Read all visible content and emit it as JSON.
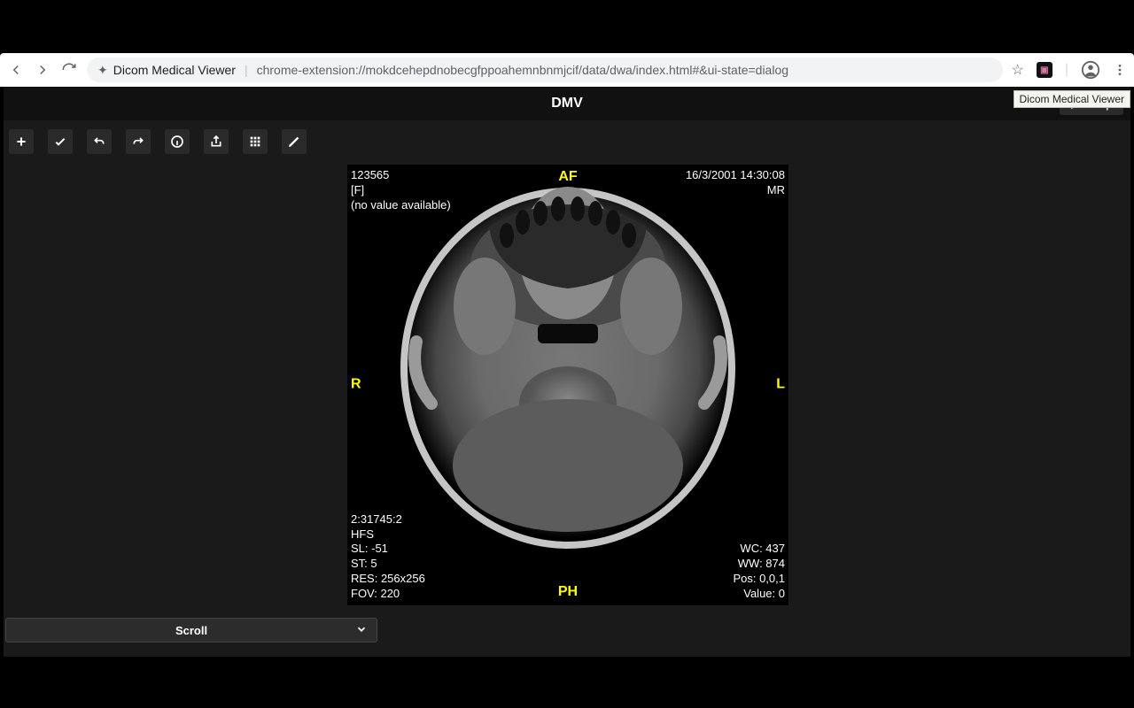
{
  "browser": {
    "page_title": "Dicom Medical Viewer",
    "url": "chrome-extension://mokdcehepdnobecgfppoahemnbnmjcif/data/dwa/index.html#&ui-state=dialog",
    "tooltip": "Dicom Medical Viewer"
  },
  "app": {
    "title": "DMV",
    "help_label": "Help"
  },
  "toolbar": {
    "add": "Add",
    "check": "Apply",
    "undo": "Undo",
    "redo": "Redo",
    "info": "Info",
    "export": "Export",
    "grid": "Grid",
    "edit": "Edit"
  },
  "bottom": {
    "mode_label": "Scroll"
  },
  "dicom": {
    "top_left": {
      "patient_id": "123565",
      "sex": "[F]",
      "value_status": "(no value available)"
    },
    "top_right": {
      "datetime": "16/3/2001 14:30:08",
      "modality": "MR"
    },
    "bottom_left": {
      "series": "2:31745:2",
      "position_ref": "HFS",
      "sl": "SL: -51",
      "st": "ST: 5",
      "res": "RES: 256x256",
      "fov": "FOV: 220"
    },
    "bottom_right": {
      "wc": "WC: 437",
      "ww": "WW: 874",
      "pos": "Pos: 0,0,1",
      "value": "Value: 0"
    },
    "orientation": {
      "top": "AF",
      "bottom": "PH",
      "left": "R",
      "right": "L"
    }
  }
}
